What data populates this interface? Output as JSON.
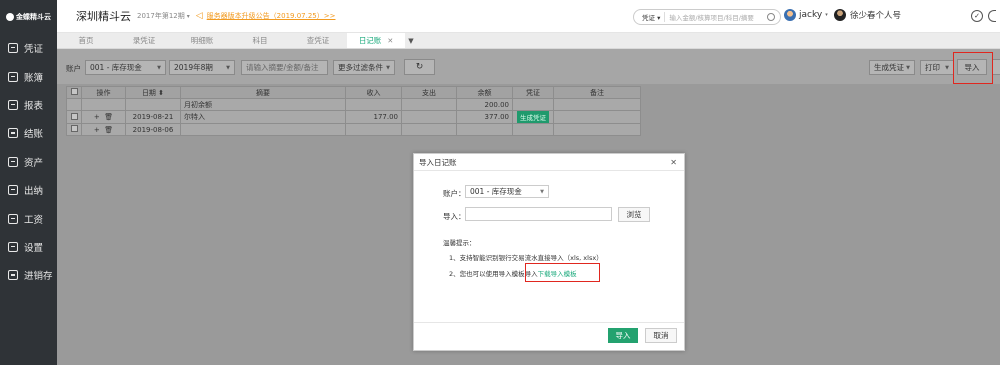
{
  "sidebar": {
    "logo": "金蝶精斗云",
    "items": [
      {
        "label": "凭证",
        "icon": "voucher-icon"
      },
      {
        "label": "账簿",
        "icon": "ledger-icon"
      },
      {
        "label": "报表",
        "icon": "report-icon"
      },
      {
        "label": "结账",
        "icon": "checkout-icon"
      },
      {
        "label": "资产",
        "icon": "asset-icon"
      },
      {
        "label": "出纳",
        "icon": "cashier-icon"
      },
      {
        "label": "工资",
        "icon": "salary-icon"
      },
      {
        "label": "设置",
        "icon": "gear-icon"
      },
      {
        "label": "进销存",
        "icon": "inventory-icon"
      }
    ]
  },
  "header": {
    "company": "深圳精斗云",
    "period": "2017年第12期",
    "notice": "服务器版本升级公告（2019.07.25）>>",
    "search_scope": "凭证",
    "search_placeholder": "输入金额/核算项目/科目/摘要",
    "user1": "jacky",
    "user2": "徐少春个人号"
  },
  "tabs": [
    {
      "label": "首页"
    },
    {
      "label": "录凭证"
    },
    {
      "label": "明细账"
    },
    {
      "label": "科目"
    },
    {
      "label": "查凭证"
    },
    {
      "label": "日记账",
      "active": true
    }
  ],
  "toolbar": {
    "account_label": "账户",
    "account_value": "001 - 库存现金",
    "period_value": "2019年8期",
    "filter_placeholder": "请输入摘要/金额/备注",
    "more_filter": "更多过滤条件",
    "gen_voucher": "生成凭证",
    "print": "打印",
    "import": "导入"
  },
  "table": {
    "headers": [
      "操作",
      "日期",
      "摘要",
      "收入",
      "支出",
      "余额",
      "凭证",
      "备注"
    ],
    "rows": [
      {
        "date": "",
        "summary": "月初余额",
        "income": "",
        "expense": "",
        "balance": "200.00",
        "voucher": "",
        "ops": false
      },
      {
        "date": "2019-08-21",
        "summary": "尔特入",
        "income": "177.00",
        "expense": "",
        "balance": "377.00",
        "voucher": "生成凭证",
        "ops": true
      },
      {
        "date": "2019-08-06",
        "summary": "",
        "income": "",
        "expense": "",
        "balance": "",
        "voucher": "",
        "ops": true
      }
    ]
  },
  "modal": {
    "title": "导入日记账",
    "account_label": "账户：",
    "account_value": "001 - 库存现金",
    "import_label": "导入：",
    "browse": "浏览",
    "tips_title": "温馨提示：",
    "tip1": "1、支持智能识别银行交易流水直接导入（xls, xlsx）",
    "tip2_prefix": "2、您也可以使用导入模板导入",
    "tip2_link": "下载导入模板",
    "ok": "导入",
    "cancel": "取消"
  },
  "colors": {
    "accent": "#19a97b",
    "notice": "#f29a1f",
    "highlight": "#e0271f"
  }
}
